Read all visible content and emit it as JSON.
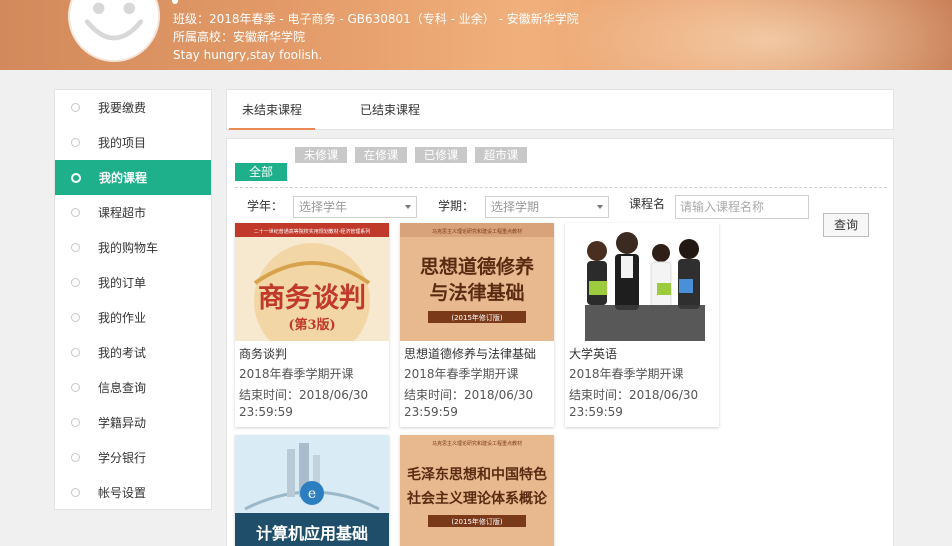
{
  "profile": {
    "class_info": "班级：2018年春季 - 电子商务 - GB630801（专科 - 业余） - 安徽新华学院",
    "school": "所属高校：安徽新华学院",
    "motto": "Stay hungry,stay foolish."
  },
  "sidebar": {
    "items": [
      {
        "label": "我要缴费"
      },
      {
        "label": "我的项目"
      },
      {
        "label": "我的课程"
      },
      {
        "label": "课程超市"
      },
      {
        "label": "我的购物车"
      },
      {
        "label": "我的订单"
      },
      {
        "label": "我的作业"
      },
      {
        "label": "我的考试"
      },
      {
        "label": "信息查询"
      },
      {
        "label": "学籍异动"
      },
      {
        "label": "学分银行"
      },
      {
        "label": "帐号设置"
      }
    ],
    "active_index": 2
  },
  "tabs": [
    {
      "label": "未结束课程"
    },
    {
      "label": "已结束课程"
    }
  ],
  "filters": {
    "all": "全部",
    "unstarted": "未修课",
    "in_progress": "在修课",
    "completed": "已修课",
    "market": "超市课"
  },
  "search": {
    "year_label": "学年：",
    "year_placeholder": "选择学年",
    "term_label": "学期：",
    "term_placeholder": "选择学期",
    "name_label": "课程名称：",
    "name_placeholder": "请输入课程名称",
    "query_button": "查询"
  },
  "courses": [
    {
      "title": "商务谈判",
      "term": "2018年春季学期开课",
      "end": "结束时间：2018/06/30 23:59:59",
      "cover_text": "商务谈判",
      "cover_sub": "(第3版)",
      "cover_top": "二十一世纪普通高等院校实用规划教材·经济管理系列"
    },
    {
      "title": "思想道德修养与法律基础",
      "term": "2018年春季学期开课",
      "end": "结束时间：2018/06/30 23:59:59",
      "cover_text1": "思想道德修养",
      "cover_text2": "与法律基础",
      "cover_sub": "(2015年修订版)",
      "cover_top": "马克思主义理论研究和建设工程重点教材"
    },
    {
      "title": "大学英语",
      "term": "2018年春季学期开课",
      "end": "结束时间：2018/06/30 23:59:59"
    },
    {
      "title": "计算机应用基础",
      "cover_text": "计算机应用基础"
    },
    {
      "title": "毛泽东思想和中国特色社会主义理论体系概论",
      "cover_text1": "毛泽东思想和中国特色",
      "cover_text2": "社会主义理论体系概论",
      "cover_sub": "(2015年修订版)",
      "cover_top": "马克思主义理论研究和建设工程重点教材"
    }
  ],
  "colors": {
    "accent": "#1db08a",
    "tab_underline": "#e98a55",
    "filter_inactive": "#c8c8c8"
  }
}
